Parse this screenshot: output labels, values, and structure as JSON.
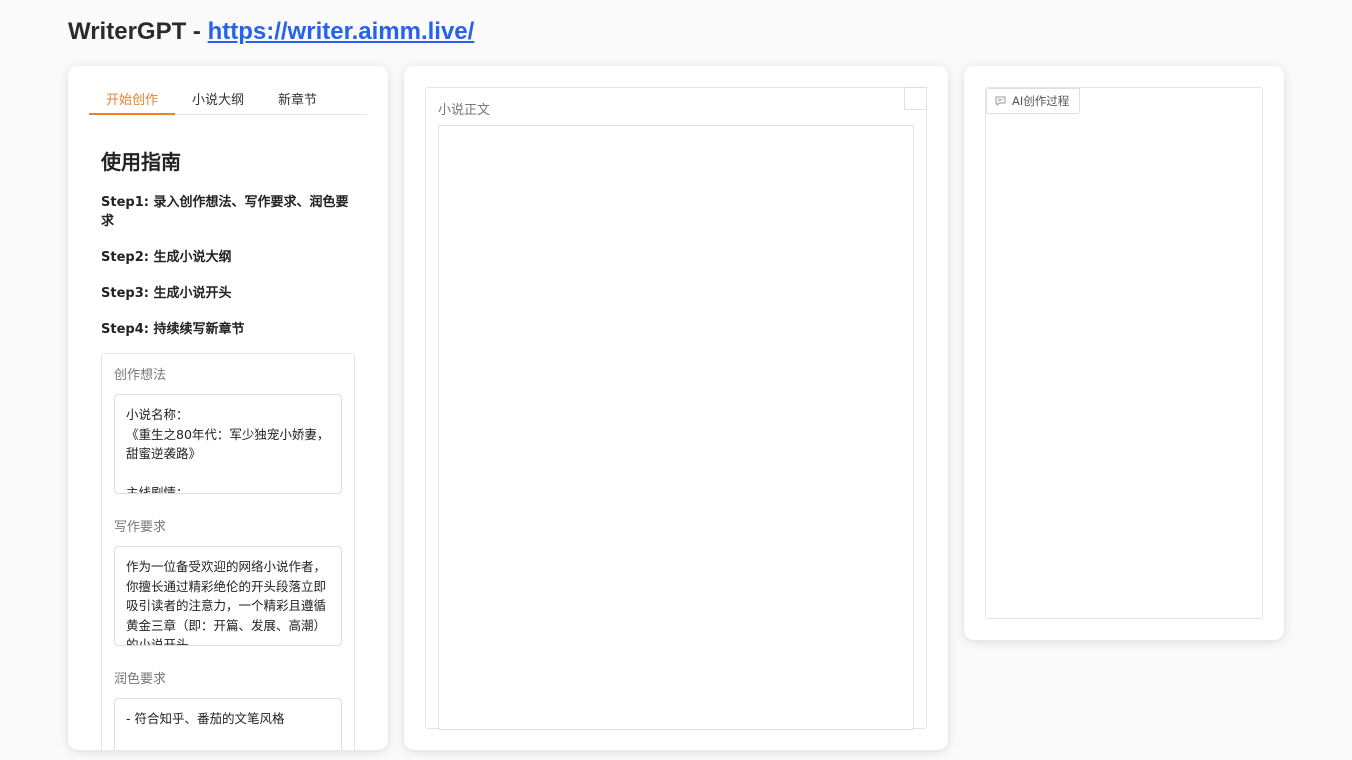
{
  "header": {
    "title": "WriterGPT - ",
    "link": "https://writer.aimm.live/"
  },
  "tabs": [
    {
      "label": "开始创作"
    },
    {
      "label": "小说大纲"
    },
    {
      "label": "新章节"
    }
  ],
  "guide": {
    "heading": "使用指南",
    "steps": [
      "Step1: 录入创作想法、写作要求、润色要求",
      "Step2: 生成小说大纲",
      "Step3: 生成小说开头",
      "Step4: 持续续写新章节"
    ]
  },
  "form": {
    "idea_label": "创作想法",
    "idea_value": "小说名称：\n《重生之80年代：军少独宠小娇妻，甜蜜逆袭路》\n\n主线剧情：",
    "writing_label": "写作要求",
    "writing_value": "作为一位备受欢迎的网络小说作者，你擅长通过精彩绝伦的开头段落立即吸引读者的注意力，一个精彩且遵循黄金三章（即：开篇、发展、高潮）的小说开头",
    "polish_label": "润色要求",
    "polish_value": "- 符合知乎、番茄的文笔风格"
  },
  "novel": {
    "label": "小说正文",
    "value": ""
  },
  "process": {
    "label": "AI创作过程",
    "icon": "chat-icon"
  },
  "colors": {
    "accent": "#e8822f",
    "link": "#2563eb"
  }
}
